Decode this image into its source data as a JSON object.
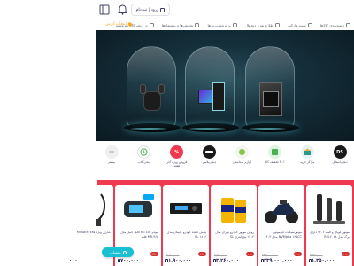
{
  "header": {
    "login_label": "ورود | ثبت‌نام",
    "icons": [
      "menu-icon",
      "bell-icon",
      "login-icon"
    ]
  },
  "nav": {
    "items": [
      {
        "label": "دسته‌بندی کالاها",
        "icon": "grid-icon"
      },
      {
        "label": "سوپرمارکت",
        "icon": "basket-icon"
      },
      {
        "label": "طلا و نقره دیجیتال",
        "icon": "gold-icon"
      },
      {
        "label": "پرفروش‌ترین‌ها",
        "icon": "fire-icon"
      },
      {
        "label": "تخفیف‌ها و پیشنهادها",
        "icon": "discount-icon"
      },
      {
        "label": "در دیجی‌کالا بفروشید",
        "icon": "shop-icon"
      }
    ],
    "location_label": "انتخاب آدرس"
  },
  "banner": {
    "alt": ""
  },
  "categories": [
    {
      "label": "DS",
      "icon": "ds-icon",
      "color": "#1a1a1a",
      "text": "DS",
      "caption": "دیجی‌استایل"
    },
    {
      "label": "مراکز خرید",
      "icon": "mall-icon",
      "color": "#e6f3f2",
      "text": "",
      "caption": "مراکز خرید"
    },
    {
      "label": "۳۰٪ تخفیف کالا",
      "icon": "discount-icon",
      "color": "#e0f4e4",
      "text": "",
      "caption": "۳۰٪ تخفیف کالا"
    },
    {
      "label": "اولین پشتیبانی",
      "icon": "support-icon",
      "color": "#f0f7ec",
      "text": "",
      "caption": "لوازم بهداشتی"
    },
    {
      "label": "دیجی‌کالا",
      "icon": "digikala-icon",
      "color": "#1a1a1a",
      "text": "",
      "caption": "دیجی‌پلاس"
    },
    {
      "label": "حراجی ویژه",
      "icon": "sale-icon",
      "color": "#ef394e",
      "text": "%",
      "caption": "فروش ویژه آخر هفته"
    },
    {
      "label": "نسخه",
      "icon": "clock-icon",
      "color": "#ffffff",
      "text": "",
      "caption": "دیجی‌کلاب"
    },
    {
      "label": "بیشتر",
      "icon": "more-icon",
      "color": "#f0f0f1",
      "text": "···",
      "caption": "بیشتر"
    }
  ],
  "offers": {
    "cards": [
      {
        "title": "موتور کوپال و فیت ۱۴۰۶ دارای برگ مدل RM-۲۰۲۸",
        "discount": "۲۰٪",
        "old": "۳,۳۵۰,۰۰۰",
        "price": "۱,۳۵۰,۰۰۰"
      },
      {
        "title": "موتورسیکلت کیوموتور NVMpha ۱۲۵CC مدل ۱۴۰۳",
        "discount": "۳۰٪",
        "old": "۴۴۳,۰۰۰,۰۰۰",
        "price": "۳۳۹,۰۰۰,۰۰۰"
      },
      {
        "title": "روغن موتور خودرو بهران مدل ۱۴۰۴ پنج لیتری SL",
        "discount": "۲۱٪",
        "old": "۶,۴۲۰,۰۰۰",
        "price": "۳,۲۶۰,۰۰۰"
      },
      {
        "title": "پخش کننده خودرو کاپیتان مدل ۱۸۰۶ CL",
        "discount": "۱۴٪",
        "old": "۲,۲۰۰,۰۰۰",
        "price": "۱,۹۰۰,۰۰۰"
      },
      {
        "title": "مودم ۴G LTE قابل حمل مدل ۳۶۵-MR فله",
        "discount": "۳۴٪",
        "old": "۱,۰۸۰,۰۰۰",
        "price": "۷۰۰,۰۰۰"
      },
      {
        "title": "شارژر ویژه ۷۸۵ MODEM",
        "discount": "",
        "old": "",
        "price": "۰۰۰"
      }
    ]
  },
  "chat": {
    "label": "پشتیبانی"
  }
}
